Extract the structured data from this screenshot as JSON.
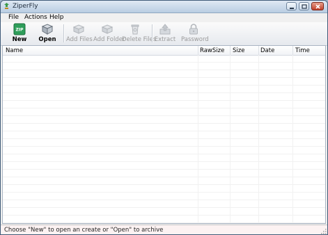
{
  "window": {
    "title": "ZiperFly",
    "icon": "app-icon",
    "controls": [
      "minimize-icon",
      "maximize-icon",
      "close-icon"
    ]
  },
  "menu": {
    "file": "File",
    "actions": "Actions",
    "help": "Help"
  },
  "toolbar": {
    "new": {
      "label": "New",
      "icon": "zip-new-icon",
      "icon_text": "ZIP",
      "enabled": true
    },
    "open": {
      "label": "Open",
      "icon": "open-archive-icon",
      "enabled": true
    },
    "add_files": {
      "label": "Add Files",
      "icon": "add-files-icon",
      "enabled": false
    },
    "add_folder": {
      "label": "Add Folder",
      "icon": "add-folder-icon",
      "enabled": false
    },
    "delete_files": {
      "label": "Delete Files",
      "icon": "delete-files-icon",
      "enabled": false
    },
    "extract": {
      "label": "Extract",
      "icon": "extract-icon",
      "enabled": false
    },
    "password": {
      "label": "Password",
      "icon": "lock-icon",
      "enabled": false
    }
  },
  "file_list": {
    "columns": [
      "Name",
      "RawSize",
      "Size",
      "Date",
      "Time"
    ],
    "rows": []
  },
  "status": {
    "text": "Choose \"New\" to open an create or \"Open\" to archive"
  },
  "colors": {
    "accent_zip": "#2e9e5a",
    "close_button": "#c0412b",
    "status_background": "#fcf2f2"
  }
}
